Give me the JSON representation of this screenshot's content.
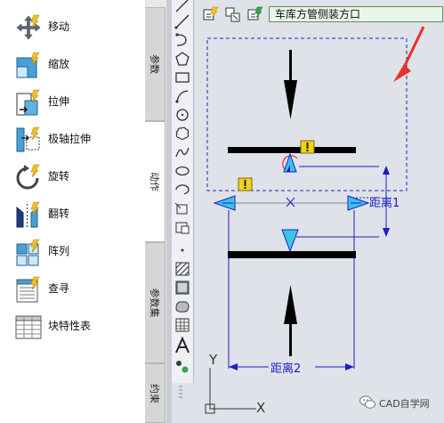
{
  "palette": {
    "actions": [
      {
        "label": "移动",
        "icon": "move-icon"
      },
      {
        "label": "缩放",
        "icon": "scale-icon"
      },
      {
        "label": "拉伸",
        "icon": "stretch-icon"
      },
      {
        "label": "极轴拉伸",
        "icon": "polar-stretch-icon"
      },
      {
        "label": "旋转",
        "icon": "rotate-icon"
      },
      {
        "label": "翻转",
        "icon": "flip-icon"
      },
      {
        "label": "阵列",
        "icon": "array-icon"
      },
      {
        "label": "查寻",
        "icon": "lookup-icon"
      },
      {
        "label": "块特性表",
        "icon": "block-table-icon"
      }
    ]
  },
  "tabs": {
    "parameters": "参数",
    "actions": "动作",
    "parameter_sets": "参数集",
    "constraints": "约束"
  },
  "drawtools": [
    "line-icon",
    "polyline-icon",
    "arc-icon",
    "polygon-icon",
    "rectangle-icon",
    "spline-icon",
    "circle-icon",
    "revcloud-icon",
    "spline-fit-icon",
    "ellipse-icon",
    "ellipse-arc-icon",
    "insert-block-icon",
    "make-block-icon",
    "point-icon",
    "hatch-icon",
    "gradient-icon",
    "region-icon",
    "table-icon",
    "multiline-text-icon",
    "add-selected-icon"
  ],
  "topbar": {
    "parameter_set_name": "车库方管侧装方口"
  },
  "drawing": {
    "dist1_label": "距离1",
    "dist2_label": "距离2",
    "ucs_y": "Y",
    "ucs_x": "X",
    "colors": {
      "cad_blue": "#1c1ccc",
      "selection_blue": "#2323d0",
      "warning_yellow": "#f2d21b",
      "arrow_red": "#e8312a",
      "grip_cyan": "#39c4e8"
    }
  },
  "watermark": {
    "text": "CAD自学网"
  }
}
